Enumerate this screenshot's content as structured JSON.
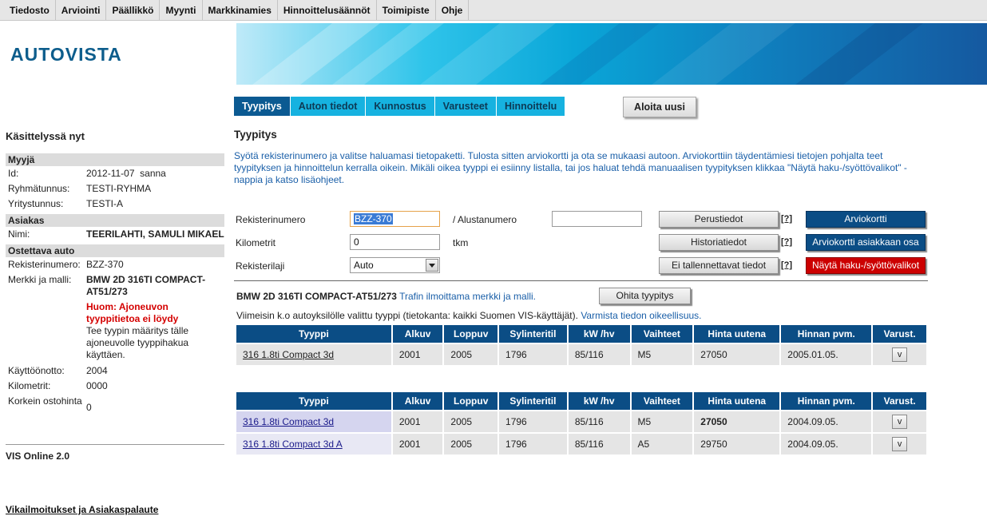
{
  "menu": [
    "Tiedosto",
    "Arviointi",
    "Päällikkö",
    "Myynti",
    "Markkinamies",
    "Hinnoittelusäännöt",
    "Toimipiste",
    "Ohje"
  ],
  "logo_text": "AUTOVISTA",
  "tabs": [
    "Tyypitys",
    "Auton tiedot",
    "Kunnostus",
    "Varusteet",
    "Hinnoittelu"
  ],
  "start_over_label": "Aloita uusi",
  "sidebar": {
    "title": "Käsittelyssä nyt",
    "seller_header": "Myyjä",
    "id_label": "Id:",
    "id_value": "2012-11-07  sanna",
    "group_label": "Ryhmätunnus:",
    "group_value": "TESTI-RYHMA",
    "company_label": "Yritystunnus:",
    "company_value": "TESTI-A",
    "customer_header": "Asiakas",
    "name_label": "Nimi:",
    "name_value": "TEERILAHTI, SAMULI MIKAEL",
    "car_header": "Ostettava auto",
    "reg_label": "Rekisterinumero:",
    "reg_value": "BZZ-370",
    "make_label": "Merkki ja malli:",
    "make_value": "BMW 2D 316TI COMPACT-AT51/273",
    "warning": "Huom: Ajoneuvon tyyppitietoa ei löydy",
    "hint": "Tee tyypin määritys tälle ajoneuvolle tyyppihakua käyttäen.",
    "intro_label": "Käyttöönotto:",
    "intro_value": "2004",
    "km_label": "Kilometrit:",
    "km_value": "0000",
    "max_label": "Korkein ostohinta",
    "max_value": "0",
    "version": "VIS Online 2.0",
    "feedback": "Vikailmoitukset ja Asiakaspalaute"
  },
  "main": {
    "title": "Tyypitys",
    "intro": "Syötä rekisterinumero ja valitse haluamasi tietopaketti. Tulosta sitten arviokortti ja ota se mukaasi autoon. Arviokorttiin täydentämiesi tietojen pohjalta teet tyypityksen ja hinnoittelun kerralla oikein. Mikäli oikea tyyppi ei esiinny listalla, tai jos haluat tehdä manuaalisen tyypityksen klikkaa \"Näytä haku-/syöttövalikot\" -nappia ja katso lisäohjeet.",
    "reg_label": "Rekisterinumero",
    "reg_value": "BZZ-370",
    "chassis_label": "/ Alustanumero",
    "chassis_value": "",
    "km_label": "Kilometrit",
    "km_value": "0",
    "km_unit": "tkm",
    "regtype_label": "Rekisterilaji",
    "regtype_value": "Auto",
    "btn_basic": "Perustiedot",
    "btn_history": "Historiatiedot",
    "btn_unsaved": "Ei tallennettavat tiedot",
    "help": "[?]",
    "btn_card": "Arviokortti",
    "btn_card_customer": "Arviokortti asiakkaan osa",
    "btn_show_search": "Näytä haku-/syöttövalikot",
    "car_model": "BMW 2D 316TI COMPACT-AT51/273",
    "car_note": "Trafin ilmoittama merkki ja malli.",
    "skip_btn": "Ohita tyypitys",
    "latest_text": "Viimeisin k.o autoyksilölle valittu tyyppi (tietokanta: kaikki Suomen VIS-käyttäjät).",
    "latest_note": "Varmista tiedon oikeellisuus."
  },
  "table_headers": [
    "Tyyppi",
    "Alkuv",
    "Loppuv",
    "Sylinteritil",
    "kW /hv",
    "Vaihteet",
    "Hinta uutena",
    "Hinnan pvm.",
    "Varust."
  ],
  "table1_rows": [
    [
      "316 1.8ti Compact 3d",
      "2001",
      "2005",
      "1796",
      "85/116",
      "M5",
      "27050",
      "2005.01.05.",
      "v"
    ]
  ],
  "table2_rows": [
    [
      "316 1.8ti Compact 3d",
      "2001",
      "2005",
      "1796",
      "85/116",
      "M5",
      "27050",
      "2004.09.05.",
      "v"
    ],
    [
      "316 1.8ti Compact 3d A",
      "2001",
      "2005",
      "1796",
      "85/116",
      "A5",
      "29750",
      "2004.09.05.",
      "v"
    ]
  ]
}
